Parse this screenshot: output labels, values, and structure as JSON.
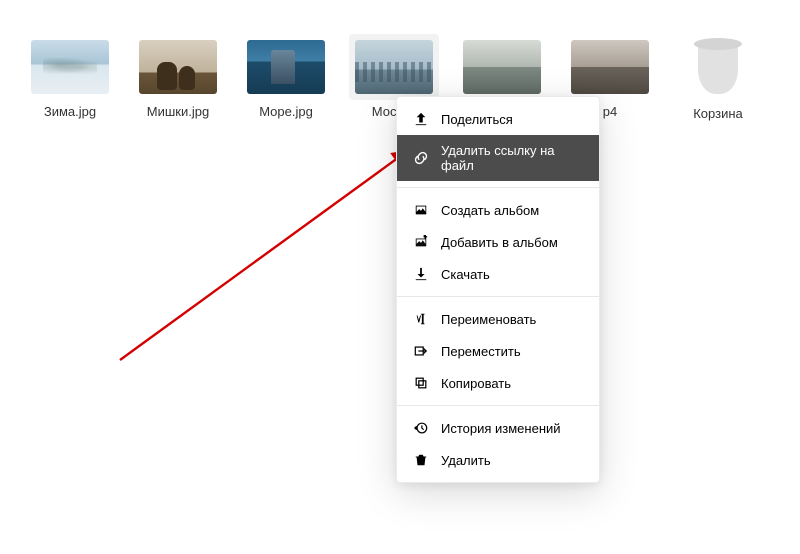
{
  "files": [
    {
      "label": "Зима.jpg"
    },
    {
      "label": "Мишки.jpg"
    },
    {
      "label": "Море.jpg"
    },
    {
      "label": "Москва"
    },
    {
      "label": ""
    },
    {
      "label": "p4"
    }
  ],
  "trash": {
    "label": "Корзина"
  },
  "menu": {
    "share": "Поделиться",
    "remove_link": "Удалить ссылку на файл",
    "create_album": "Создать альбом",
    "add_to_album": "Добавить в альбом",
    "download": "Скачать",
    "rename": "Переименовать",
    "move": "Переместить",
    "copy": "Копировать",
    "history": "История изменений",
    "delete": "Удалить"
  }
}
